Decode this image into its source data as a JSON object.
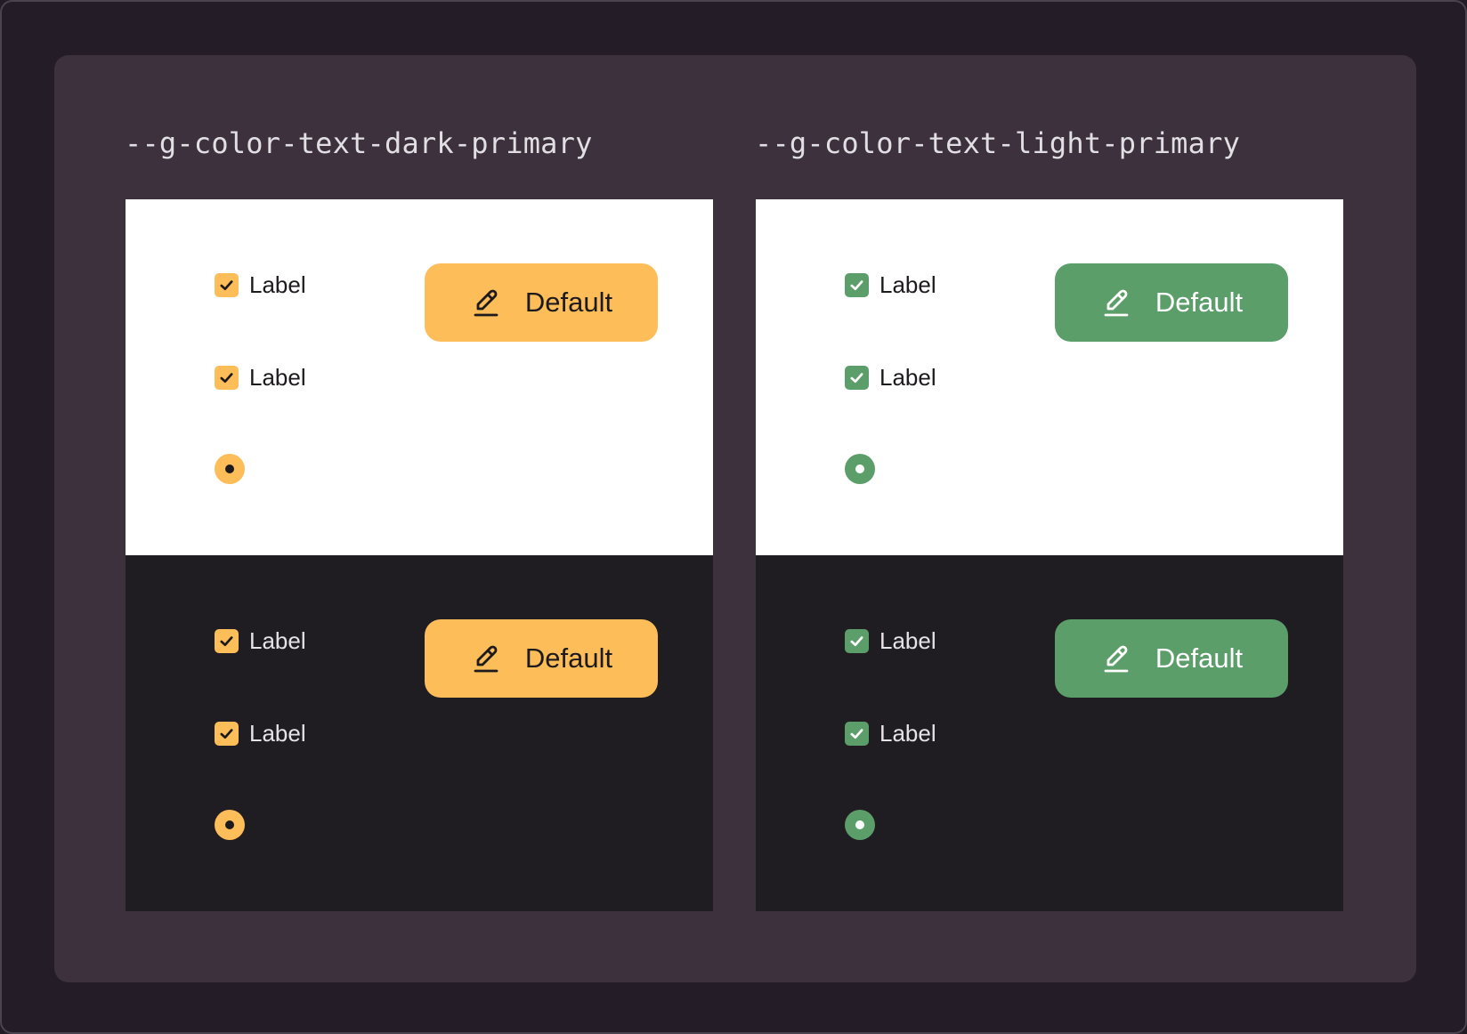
{
  "columns": [
    {
      "title": "--g-color-text-dark-primary",
      "accent": "#fdbd58",
      "ink": "#1d1a1e",
      "tiles": [
        {
          "theme": "light",
          "checkbox_labels": [
            "Label",
            "Label"
          ],
          "button_label": "Default",
          "button_icon": "pencil-icon"
        },
        {
          "theme": "dark",
          "checkbox_labels": [
            "Label",
            "Label"
          ],
          "button_label": "Default",
          "button_icon": "pencil-icon"
        }
      ]
    },
    {
      "title": "--g-color-text-light-primary",
      "accent": "#5b9e69",
      "ink": "#ffffff",
      "tiles": [
        {
          "theme": "light",
          "checkbox_labels": [
            "Label",
            "Label"
          ],
          "button_label": "Default",
          "button_icon": "pencil-icon"
        },
        {
          "theme": "dark",
          "checkbox_labels": [
            "Label",
            "Label"
          ],
          "button_label": "Default",
          "button_icon": "pencil-icon"
        }
      ]
    }
  ],
  "colors": {
    "page_background": "#231c25",
    "panel_background": "#3c313c",
    "light_surface": "#ffffff",
    "dark_surface": "#201d22",
    "light_surface_text": "#1d1a1e",
    "dark_surface_text": "#e6e3e8"
  }
}
